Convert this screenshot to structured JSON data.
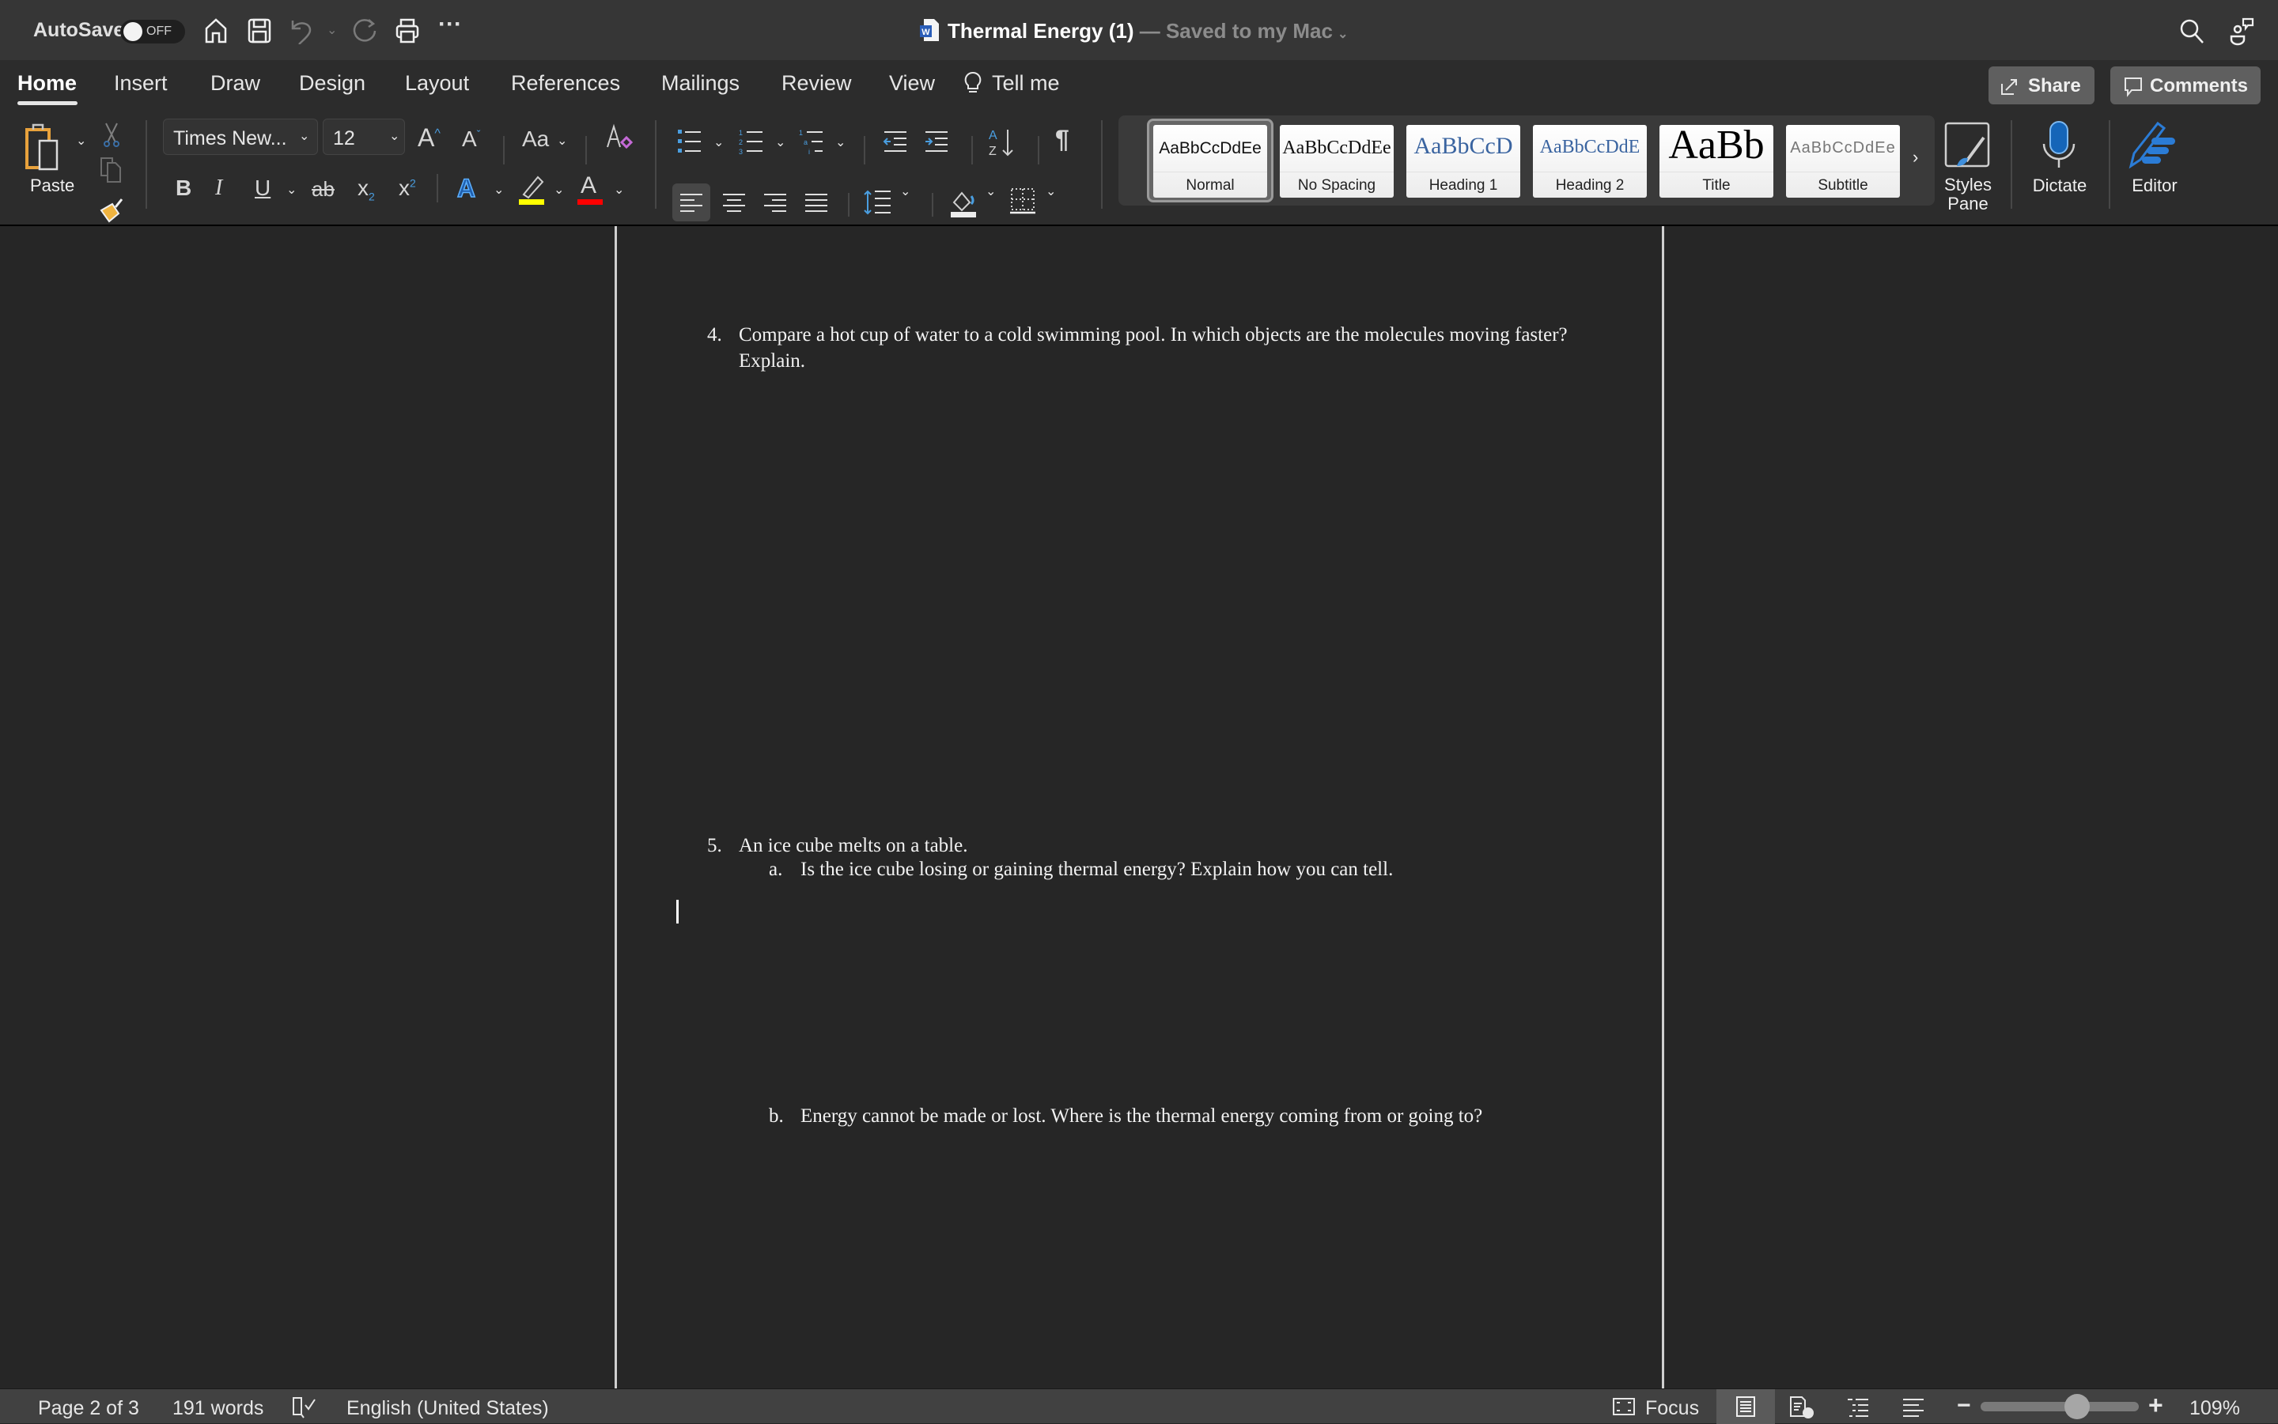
{
  "titlebar": {
    "autosave_label": "AutoSave",
    "autosave_state": "OFF",
    "doc_title": "Thermal Energy (1)",
    "doc_status": " — Saved to my Mac",
    "icons": [
      "home-icon",
      "save-icon",
      "undo-icon",
      "redo-icon",
      "print-icon",
      "more-icon",
      "search-icon",
      "share-people-icon"
    ]
  },
  "tabs": [
    {
      "label": "Home",
      "active": true
    },
    {
      "label": "Insert"
    },
    {
      "label": "Draw"
    },
    {
      "label": "Design"
    },
    {
      "label": "Layout"
    },
    {
      "label": "References"
    },
    {
      "label": "Mailings"
    },
    {
      "label": "Review"
    },
    {
      "label": "View"
    }
  ],
  "tell_me": "Tell me",
  "share_label": "Share",
  "comments_label": "Comments",
  "ribbon": {
    "paste_label": "Paste",
    "font_name": "Times New...",
    "font_size": "12",
    "change_case": "Aa",
    "bold": "B",
    "italic": "I",
    "underline": "U",
    "strike": "ab",
    "subscript": "x",
    "superscript": "x",
    "text_effects": "A",
    "font_color": "A",
    "highlight_color": "#ffff00",
    "font_color_value": "#ff0000",
    "pilcrow": "¶",
    "styles": [
      {
        "preview": "AaBbCcDdEe",
        "name": "Normal",
        "selected": true
      },
      {
        "preview": "AaBbCcDdEe",
        "name": "No Spacing"
      },
      {
        "preview": "AaBbCcD",
        "name": "Heading 1"
      },
      {
        "preview": "AaBbCcDdE",
        "name": "Heading 2"
      },
      {
        "preview": "AaBb",
        "name": "Title"
      },
      {
        "preview": "AaBbCcDdEe",
        "name": "Subtitle"
      }
    ],
    "styles_pane_label_1": "Styles",
    "styles_pane_label_2": "Pane",
    "dictate_label": "Dictate",
    "editor_label": "Editor"
  },
  "document": {
    "q4_num": "4.",
    "q4_line1": "Compare a hot cup of water to a cold swimming pool. In which objects are the molecules moving faster?",
    "q4_line2": "Explain.",
    "q5_num": "5.",
    "q5_text": "An ice cube melts on a table.",
    "q5a_num": "a.",
    "q5a_text": "Is the ice cube losing or gaining thermal energy? Explain how you can tell.",
    "q5b_num": "b.",
    "q5b_text": "Energy cannot be made or lost. Where is the thermal energy coming from or going to?"
  },
  "statusbar": {
    "page": "Page 2 of 3",
    "words": "191 words",
    "language": "English (United States)",
    "focus_label": "Focus",
    "zoom_value": "109%",
    "zoom_percent": 109
  }
}
